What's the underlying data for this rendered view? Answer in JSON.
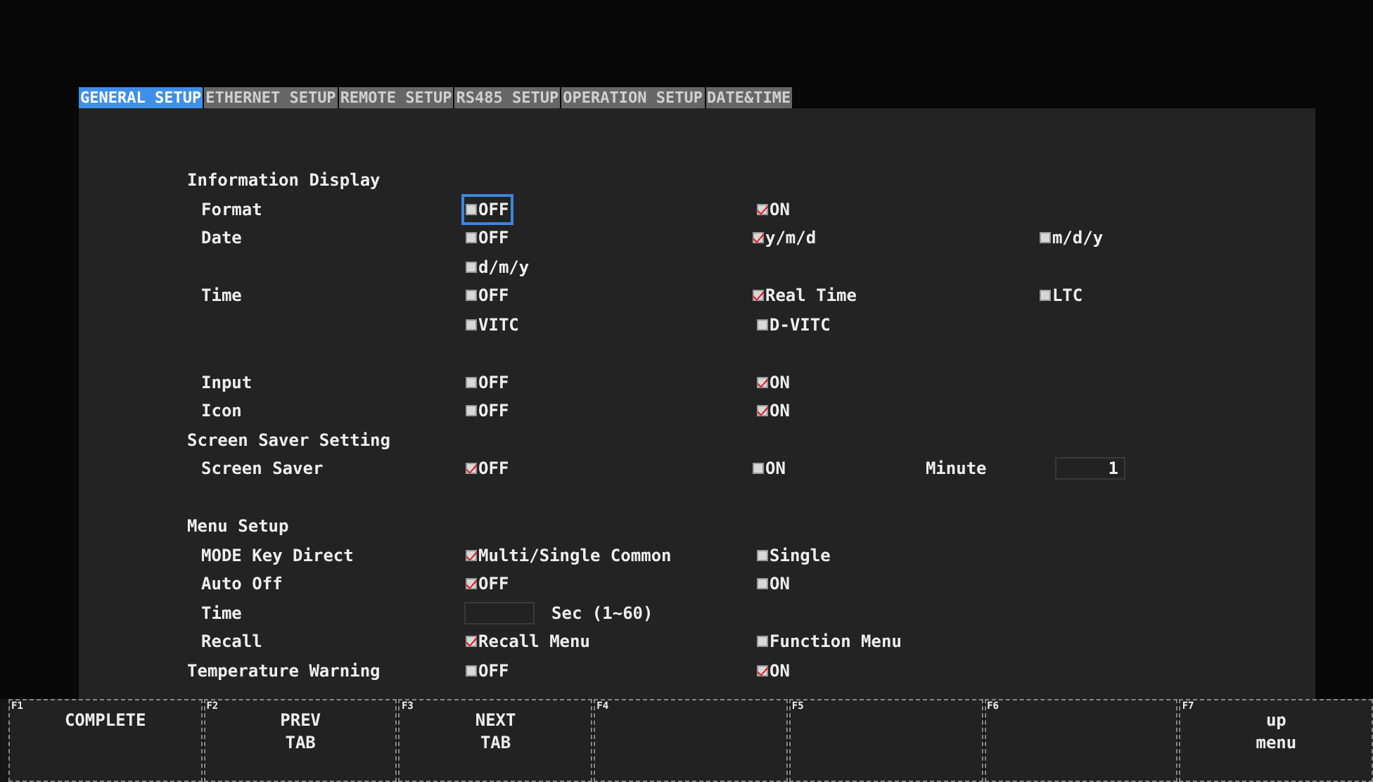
{
  "tabs": [
    {
      "label": "GENERAL SETUP",
      "selected": true
    },
    {
      "label": "ETHERNET SETUP",
      "selected": false
    },
    {
      "label": "REMOTE SETUP",
      "selected": false
    },
    {
      "label": "RS485 SETUP",
      "selected": false
    },
    {
      "label": "OPERATION SETUP",
      "selected": false
    },
    {
      "label": "DATE&TIME",
      "selected": false
    }
  ],
  "rows": [
    {
      "kind": "heading",
      "label": "Information Display"
    },
    {
      "kind": "item",
      "label": "Format",
      "options": [
        {
          "kind": "radio",
          "label": "OFF",
          "checked": false,
          "focused": true
        },
        {
          "kind": "radio",
          "label": "ON",
          "checked": true,
          "focused": false
        }
      ]
    },
    {
      "kind": "item",
      "label": "Date",
      "options": [
        {
          "kind": "radio",
          "label": "OFF",
          "checked": false,
          "focused": false
        },
        {
          "kind": "radio",
          "label": "y/m/d",
          "checked": true,
          "focused": false
        },
        {
          "kind": "radio",
          "label": "m/d/y",
          "checked": false,
          "focused": false
        }
      ]
    },
    {
      "kind": "item",
      "options": [
        {
          "kind": "radio",
          "label": "d/m/y",
          "checked": false,
          "focused": false
        }
      ]
    },
    {
      "kind": "item",
      "label": "Time",
      "options": [
        {
          "kind": "radio",
          "label": "OFF",
          "checked": false,
          "focused": false
        },
        {
          "kind": "radio",
          "label": "Real Time",
          "checked": true,
          "focused": false
        },
        {
          "kind": "radio",
          "label": "LTC",
          "checked": false,
          "focused": false
        }
      ]
    },
    {
      "kind": "item",
      "options": [
        {
          "kind": "radio",
          "label": "VITC",
          "checked": false,
          "focused": false
        },
        {
          "kind": "radio",
          "label": "D-VITC",
          "checked": false,
          "focused": false
        }
      ]
    },
    {
      "kind": "gap"
    },
    {
      "kind": "item",
      "label": "Input",
      "options": [
        {
          "kind": "radio",
          "label": "OFF",
          "checked": false,
          "focused": false
        },
        {
          "kind": "radio",
          "label": "ON",
          "checked": true,
          "focused": false
        }
      ]
    },
    {
      "kind": "item",
      "label": "Icon",
      "options": [
        {
          "kind": "radio",
          "label": "OFF",
          "checked": false,
          "focused": false
        },
        {
          "kind": "radio",
          "label": "ON",
          "checked": true,
          "focused": false
        }
      ]
    },
    {
      "kind": "heading",
      "label": "Screen Saver Setting"
    },
    {
      "kind": "item",
      "label": "Screen Saver",
      "options": [
        {
          "kind": "radio",
          "label": "OFF",
          "checked": true,
          "focused": false
        },
        {
          "kind": "radio",
          "label": "ON",
          "checked": false,
          "focused": false
        },
        {
          "kind": "field",
          "label": "Minute",
          "value": "1"
        }
      ]
    },
    {
      "kind": "gap"
    },
    {
      "kind": "heading",
      "label": "Menu Setup"
    },
    {
      "kind": "item",
      "label": "MODE Key Direct",
      "options": [
        {
          "kind": "radio",
          "label": "Multi/Single Common",
          "checked": true,
          "focused": false
        },
        {
          "kind": "radio",
          "label": "Single",
          "checked": false,
          "focused": false
        }
      ]
    },
    {
      "kind": "item",
      "label": "Auto Off",
      "options": [
        {
          "kind": "radio",
          "label": "OFF",
          "checked": true,
          "focused": false
        },
        {
          "kind": "radio",
          "label": "ON",
          "checked": false,
          "focused": false
        }
      ]
    },
    {
      "kind": "item",
      "label": "Time",
      "options": [
        {
          "kind": "field",
          "unit": "Sec (1~60)"
        }
      ]
    },
    {
      "kind": "item",
      "label": "Recall",
      "options": [
        {
          "kind": "radio",
          "label": "Recall Menu",
          "checked": true,
          "focused": false
        },
        {
          "kind": "radio",
          "label": "Function Menu",
          "checked": false,
          "focused": false
        }
      ]
    },
    {
      "kind": "heading",
      "label": "Temperature Warning",
      "options": [
        {
          "kind": "radio",
          "label": "OFF",
          "checked": false,
          "focused": false
        },
        {
          "kind": "radio",
          "label": "ON",
          "checked": true,
          "focused": false
        }
      ]
    }
  ],
  "function_keys": [
    {
      "key": "F1",
      "label": "COMPLETE"
    },
    {
      "key": "F2",
      "label": "PREV\nTAB"
    },
    {
      "key": "F3",
      "label": "NEXT\nTAB"
    },
    {
      "key": "F4"
    },
    {
      "key": "F5"
    },
    {
      "key": "F6"
    },
    {
      "key": "F7",
      "label": "up\nmenu"
    }
  ]
}
